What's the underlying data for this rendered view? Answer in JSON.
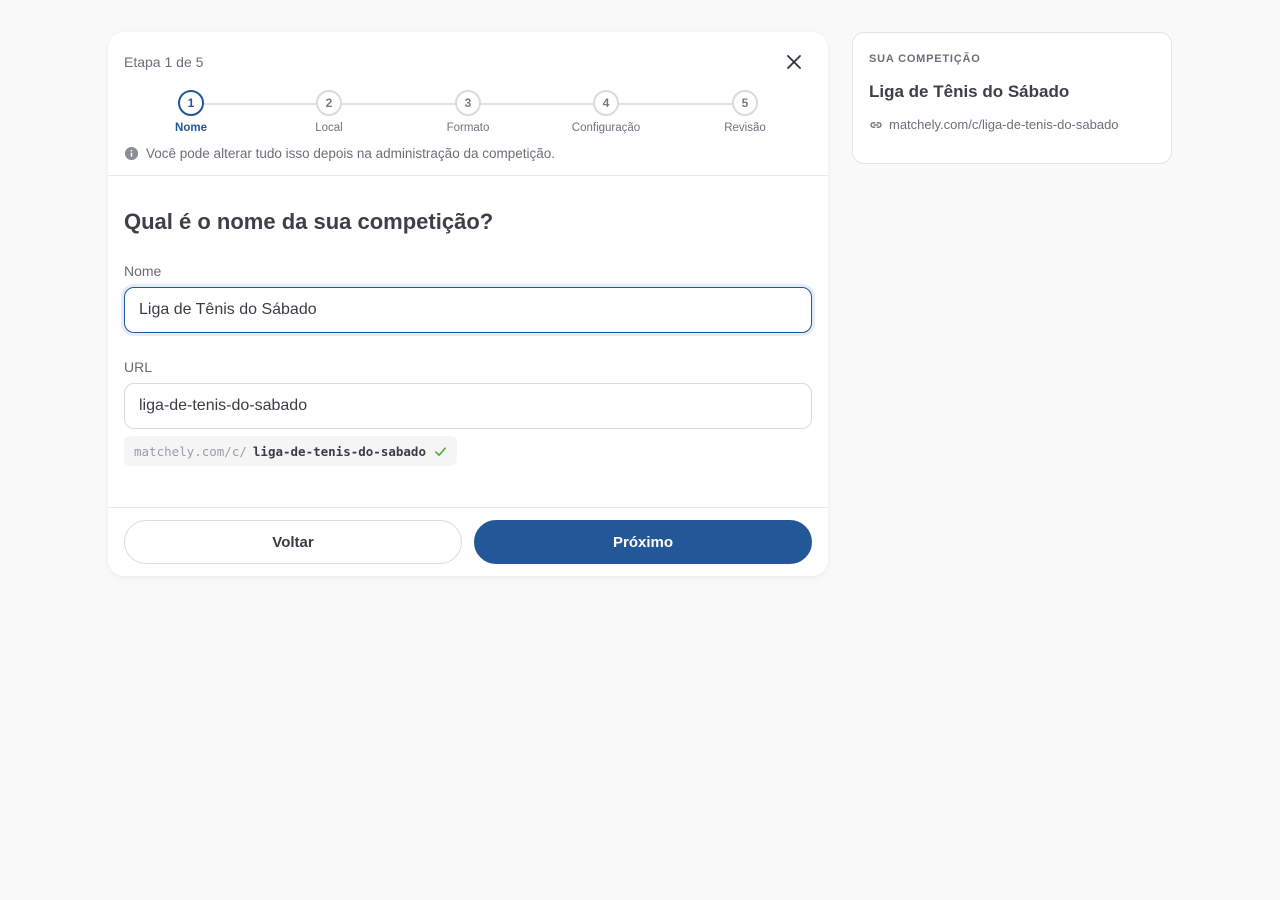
{
  "wizard": {
    "step_counter": "Etapa 1 de 5",
    "steps": [
      {
        "number": "1",
        "label": "Nome",
        "active": true
      },
      {
        "number": "2",
        "label": "Local",
        "active": false
      },
      {
        "number": "3",
        "label": "Formato",
        "active": false
      },
      {
        "number": "4",
        "label": "Configuração",
        "active": false
      },
      {
        "number": "5",
        "label": "Revisão",
        "active": false
      }
    ],
    "info_text": "Você pode alterar tudo isso depois na administração da competição.",
    "question": "Qual é o nome da sua competição?",
    "name_field": {
      "label": "Nome",
      "value": "Liga de Tênis do Sábado"
    },
    "url_field": {
      "label": "URL",
      "value": "liga-de-tenis-do-sabado"
    },
    "slug_preview": {
      "base": "matchely.com/c/",
      "slug": "liga-de-tenis-do-sabado"
    },
    "back_label": "Voltar",
    "next_label": "Próximo"
  },
  "summary": {
    "heading": "SUA COMPETIÇÃO",
    "name": "Liga de Tênis do Sábado",
    "url": "matchely.com/c/liga-de-tenis-do-sabado"
  },
  "colors": {
    "accent": "#235898",
    "success": "#5aab3c",
    "background": "#f9f9f9"
  },
  "icons": {
    "close": "close-icon",
    "info": "info-icon",
    "check": "check-icon",
    "link": "link-icon"
  }
}
